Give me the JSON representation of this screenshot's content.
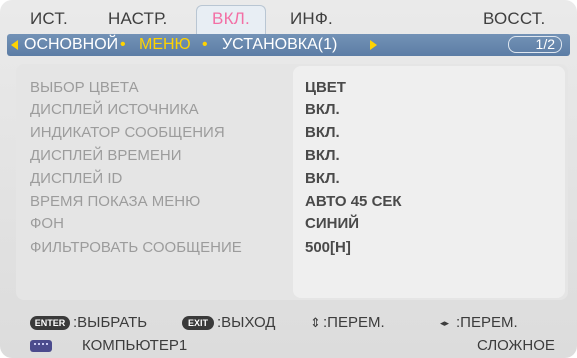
{
  "tabs": [
    {
      "label": "ИСТ.",
      "active": false
    },
    {
      "label": "НАСТР.",
      "active": false
    },
    {
      "label": "ВКЛ.",
      "active": true
    },
    {
      "label": "ИНФ.",
      "active": false
    },
    {
      "label": "ВОССТ.",
      "active": false
    }
  ],
  "subtabs": [
    {
      "label": "ОСНОВНОЙ",
      "active": false
    },
    {
      "label": "МЕНЮ",
      "active": true
    },
    {
      "label": "УСТАНОВКА(1)",
      "active": false
    }
  ],
  "page_indicator": "1/2",
  "settings": [
    {
      "label": "ВЫБОР ЦВЕТА",
      "value": "ЦВЕТ"
    },
    {
      "label": "ДИСПЛЕЙ ИСТОЧНИКА",
      "value": "ВКЛ."
    },
    {
      "label": "ИНДИКАТОР СООБЩЕНИЯ",
      "value": "ВКЛ."
    },
    {
      "label": "ДИСПЛЕЙ ВРЕМЕНИ",
      "value": "ВКЛ."
    },
    {
      "label": "ДИСПЛЕЙ ID",
      "value": "ВКЛ."
    },
    {
      "label": "ВРЕМЯ ПОКАЗА МЕНЮ",
      "value": "АВТО 45 СЕК"
    },
    {
      "label": "ФОН",
      "value": "СИНИЙ"
    },
    {
      "label": "ФИЛЬТРОВАТЬ СООБЩЕНИЕ",
      "value": "500[Н]"
    }
  ],
  "hints": {
    "enter_key": "ENTER",
    "enter_text": ":ВЫБРАТЬ",
    "exit_key": "EXIT",
    "exit_text": ":ВЫХОД",
    "updown_glyph": "⇕",
    "updown_text": ":ПЕРЕМ.",
    "leftright_glyph": "◂▸",
    "leftright_text": ":ПЕРЕМ."
  },
  "source": {
    "icon": "computer-input-icon",
    "name": "КОМПЬЮТЕР1",
    "mode": "СЛОЖНОЕ"
  },
  "colors": {
    "active_tab": "#f36fa5",
    "subbar": "#6a8ab0",
    "active_subtab": "#ffd300"
  }
}
